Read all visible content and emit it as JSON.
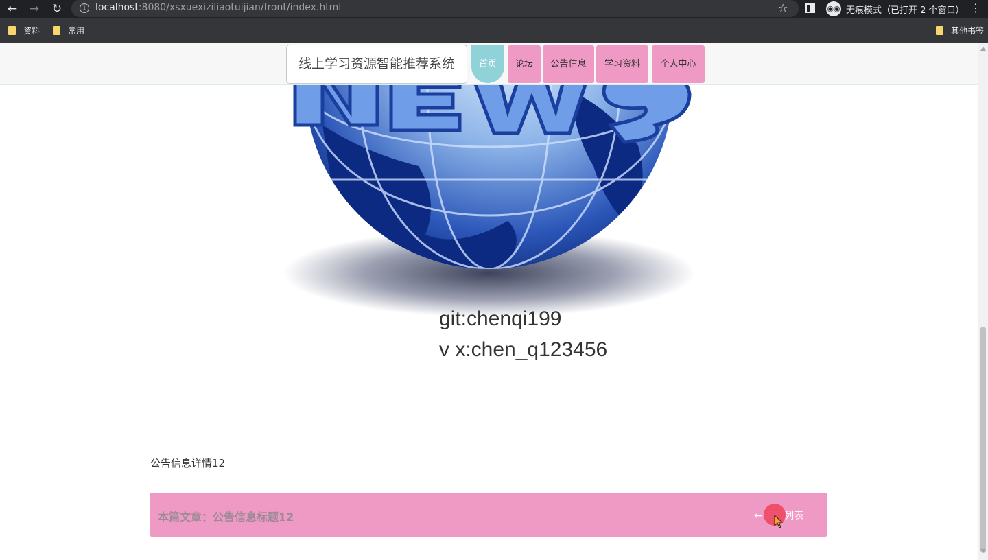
{
  "browser": {
    "url_host": "localhost",
    "url_rest": ":8080/xsxuexiziliaotuijian/front/index.html",
    "incognito_label": "无痕模式（已打开 2 个窗口）",
    "bookmarks": [
      "资料",
      "常用"
    ],
    "other_bookmarks": "其他书签"
  },
  "site": {
    "title": "线上学习资源智能推荐系统",
    "nav": [
      "首页",
      "论坛",
      "公告信息",
      "学习资料",
      "个人中心"
    ]
  },
  "content": {
    "contact_lines": [
      "git:chenqi199",
      "v x:chen_q123456"
    ],
    "detail_label": "公告信息详情12",
    "article_prefix": "本篇文章：公告信息标题12",
    "back_label": "← 返回列表"
  },
  "colors": {
    "nav_pink": "#ef9ac4",
    "nav_active": "#8fd2d8",
    "globe_blue": "#1a3f9b"
  }
}
